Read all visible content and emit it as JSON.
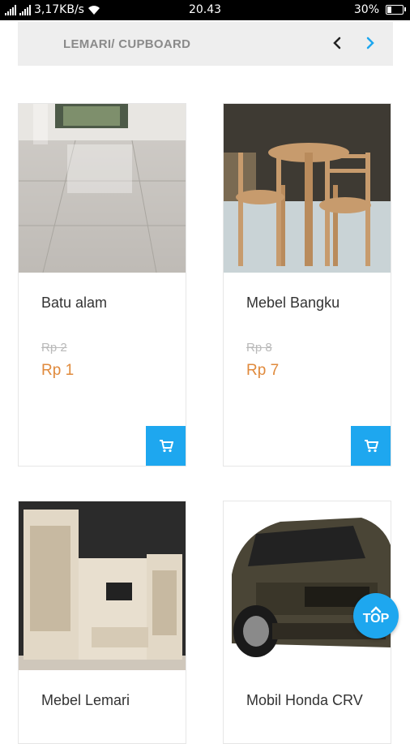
{
  "status_bar": {
    "network_speed": "3,17KB/s",
    "time": "20.43",
    "battery": "30%",
    "battery_level": 0.3
  },
  "category": {
    "title": "LEMARI/ CUPBOARD"
  },
  "products": [
    {
      "name": "Batu alam",
      "old_price": "Rp 2",
      "price": "Rp 1"
    },
    {
      "name": "Mebel Bangku",
      "old_price": "Rp 8",
      "price": "Rp 7"
    },
    {
      "name": "Mebel Lemari",
      "old_price": "",
      "price": ""
    },
    {
      "name": "Mobil Honda CRV",
      "old_price": "",
      "price": ""
    }
  ],
  "top_button": {
    "label": "TOP"
  },
  "colors": {
    "accent": "#1ea7ef",
    "price": "#e08a3c"
  }
}
